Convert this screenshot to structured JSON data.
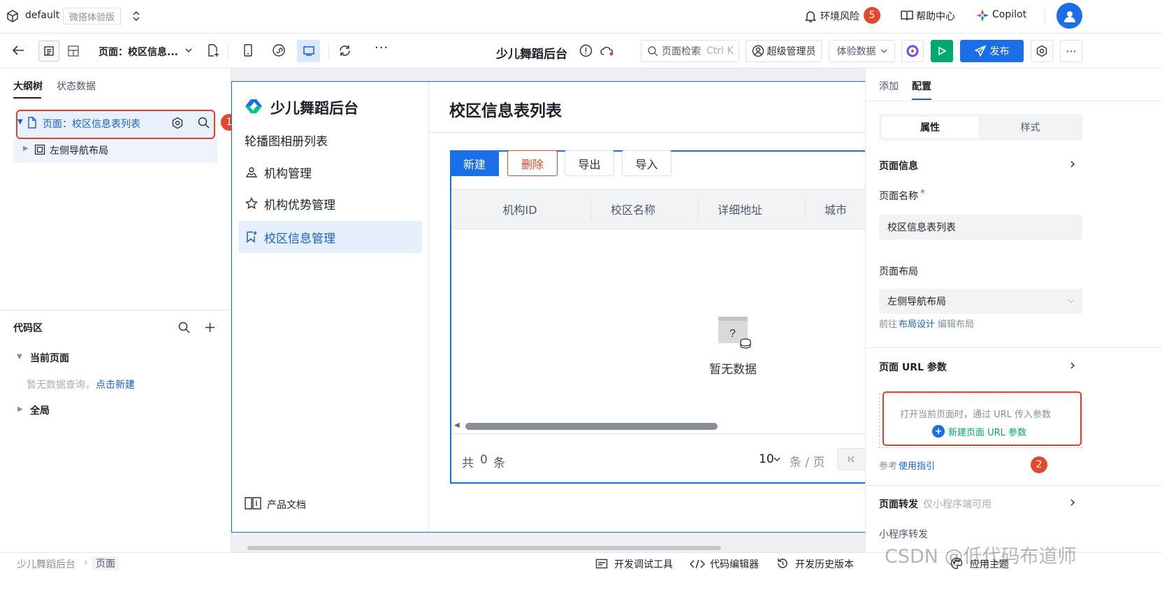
{
  "topbar": {
    "env_name": "default",
    "env_tag": "微搭体验版",
    "env_risk_label": "环境风险",
    "env_risk_count": "5",
    "help_label": "帮助中心",
    "copilot_label": "Copilot"
  },
  "toolbar": {
    "page_select": "页面：校区信息...",
    "app_title": "少儿舞蹈后台",
    "search_label": "页面检索",
    "search_shortcut": "Ctrl K",
    "user_label": "超级管理员",
    "data_select": "体验数据",
    "publish_label": "发布"
  },
  "left": {
    "tabs": [
      "大纲树",
      "状态数据"
    ],
    "tree": [
      {
        "label": "页面：校区信息表列表"
      },
      {
        "label": "左侧导航布局"
      }
    ],
    "marker1": "1",
    "code_title": "代码区",
    "current_page": "当前页面",
    "empty_query": "暂无数据查询，",
    "create_link": "点击新建",
    "global": "全局"
  },
  "canvas": {
    "brand": "少儿舞蹈后台",
    "nav": [
      "轮播图相册列表",
      "机构管理",
      "机构优势管理",
      "校区信息管理"
    ],
    "doc_label": "产品文档",
    "page_title": "校区信息表列表",
    "buttons": {
      "new": "新建",
      "delete": "删除",
      "export": "导出",
      "import": "导入"
    },
    "columns": [
      "机构ID",
      "校区名称",
      "详细地址",
      "城市"
    ],
    "empty": "暂无数据",
    "total_prefix": "共",
    "total_count": "0",
    "total_suffix": "条",
    "page_size": "10",
    "page_unit": "条 / 页"
  },
  "right": {
    "tabs": [
      "添加",
      "配置"
    ],
    "subtabs": [
      "属性",
      "样式"
    ],
    "page_info": "页面信息",
    "page_name_label": "页面名称",
    "page_name_value": "校区信息表列表",
    "layout_label": "页面布局",
    "layout_value": "左侧导航布局",
    "layout_link_pre": "前往",
    "layout_link": "布局设计",
    "layout_link_post": "编辑布局",
    "url_params": "页面 URL 参数",
    "url_hint": "打开当前页面时，通过 URL 传入参数",
    "url_new": "新建页面 URL 参数",
    "ref_pre": "参考",
    "ref_link": "使用指引",
    "marker2": "2",
    "forward": "页面转发",
    "forward_note": "仅小程序端可用",
    "mp_forward": "小程序转发"
  },
  "bottom": {
    "crumb": [
      "少儿舞蹈后台",
      "页面"
    ],
    "debug": "开发调试工具",
    "code_editor": "代码编辑器",
    "history": "开发历史版本",
    "watermark": "CSDN @低代码布道师",
    "theme": "应用主题"
  },
  "colors": {
    "primary": "#1a6ee8",
    "danger": "#e0492c",
    "green": "#00a870"
  }
}
